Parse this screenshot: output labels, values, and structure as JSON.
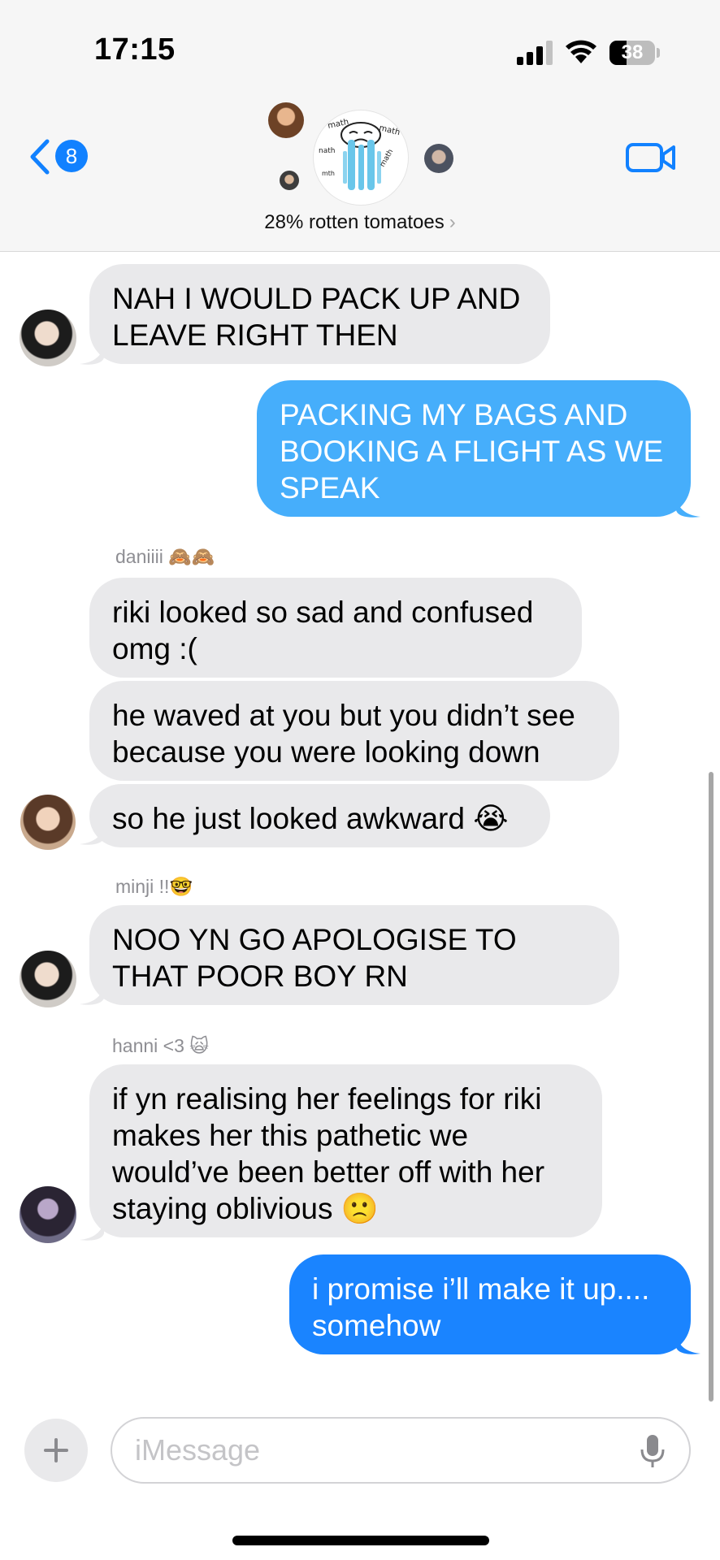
{
  "status_bar": {
    "time": "17:15",
    "battery": "38",
    "battery_level": 0.38
  },
  "header": {
    "back_badge": "8",
    "group_name": "28% rotten tomatoes",
    "group_avatar_icon": "crying-cartoon-icon"
  },
  "messages": [
    {
      "from": "in",
      "text": "NAH I WOULD PACK UP AND LEAVE RIGHT THEN"
    },
    {
      "from": "out",
      "text": "PACKING MY BAGS AND BOOKING A FLIGHT AS WE SPEAK"
    },
    {
      "from": "in",
      "sender": "daniiii 🙈🙈",
      "text": "riki looked so sad and confused omg :("
    },
    {
      "from": "in",
      "text": "he waved at you but you didn’t see because you were looking down"
    },
    {
      "from": "in",
      "text": "so he just looked awkward 😭"
    },
    {
      "from": "in",
      "sender": "minji !!🤓",
      "text": "NOO YN GO APOLOGISE TO THAT POOR BOY RN"
    },
    {
      "from": "in",
      "sender": "hanni <3 🙀",
      "text": "if yn realising her feelings for riki makes her this pathetic we would’ve been better off with her staying oblivious 🙁"
    },
    {
      "from": "out",
      "text": "i promise i’ll make it up.... somehow"
    }
  ],
  "composer": {
    "placeholder": "iMessage"
  },
  "colors": {
    "outgoing": "#46aefb",
    "outgoing_latest": "#1a84ff",
    "incoming": "#e9e9eb",
    "accent": "#1181ff"
  }
}
